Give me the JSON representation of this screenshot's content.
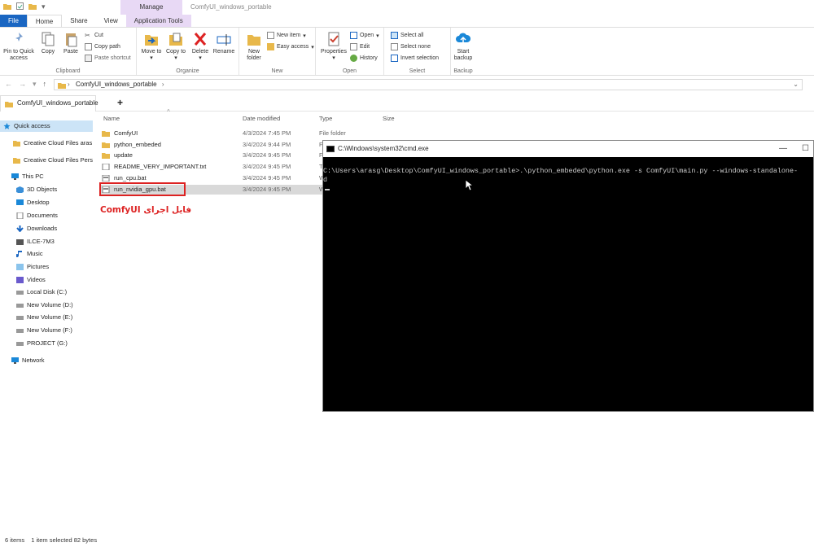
{
  "window": {
    "title": "ComfyUI_windows_portable"
  },
  "ribbon_tabs": {
    "file": "File",
    "home": "Home",
    "share": "Share",
    "view": "View",
    "manage_header": "Manage",
    "app_tools": "Application Tools"
  },
  "clipboard": {
    "pin": "Pin to Quick access",
    "copy": "Copy",
    "paste": "Paste",
    "cut": "Cut",
    "copy_path": "Copy path",
    "paste_shortcut": "Paste shortcut",
    "label": "Clipboard"
  },
  "organize": {
    "move_to": "Move to",
    "copy_to": "Copy to",
    "delete": "Delete",
    "rename": "Rename",
    "label": "Organize"
  },
  "new": {
    "new_folder": "New folder",
    "new_item": "New item",
    "easy_access": "Easy access",
    "label": "New"
  },
  "open": {
    "properties": "Properties",
    "open": "Open",
    "edit": "Edit",
    "history": "History",
    "label": "Open"
  },
  "select": {
    "select_all": "Select all",
    "select_none": "Select none",
    "invert": "Invert selection",
    "label": "Select"
  },
  "backup": {
    "start_backup": "Start backup",
    "label": "Backup"
  },
  "address": {
    "path": "ComfyUI_windows_portable"
  },
  "folder_tab": {
    "label": "ComfyUI_windows_portable",
    "add": "+"
  },
  "nav": [
    {
      "label": "Quick access",
      "icon": "star-icon"
    },
    {
      "label": "Creative Cloud Files  aras",
      "icon": "folder-icon"
    },
    {
      "label": "Creative Cloud Files Perso",
      "icon": "folder-icon"
    },
    {
      "label": "This PC",
      "icon": "pc-icon"
    },
    {
      "label": "3D Objects",
      "icon": "cube-icon"
    },
    {
      "label": "Desktop",
      "icon": "desktop-icon"
    },
    {
      "label": "Documents",
      "icon": "documents-icon"
    },
    {
      "label": "Downloads",
      "icon": "download-icon"
    },
    {
      "label": "ILCE-7M3",
      "icon": "camera-icon"
    },
    {
      "label": "Music",
      "icon": "music-icon"
    },
    {
      "label": "Pictures",
      "icon": "pictures-icon"
    },
    {
      "label": "Videos",
      "icon": "videos-icon"
    },
    {
      "label": "Local Disk (C:)",
      "icon": "drive-icon"
    },
    {
      "label": "New Volume (D:)",
      "icon": "drive-icon"
    },
    {
      "label": "New Volume (E:)",
      "icon": "drive-icon"
    },
    {
      "label": "New Volume (F:)",
      "icon": "drive-icon"
    },
    {
      "label": "PROJECT (G:)",
      "icon": "drive-icon"
    },
    {
      "label": "Network",
      "icon": "network-icon"
    }
  ],
  "columns": {
    "name": "Name",
    "date": "Date modified",
    "type": "Type",
    "size": "Size"
  },
  "files": [
    {
      "name": "ComfyUI",
      "date": "4/3/2024 7:45 PM",
      "type": "File folder",
      "kind": "folder"
    },
    {
      "name": "python_embeded",
      "date": "3/4/2024 9:44 PM",
      "type": "F",
      "kind": "folder"
    },
    {
      "name": "update",
      "date": "3/4/2024 9:45 PM",
      "type": "F",
      "kind": "folder"
    },
    {
      "name": "README_VERY_IMPORTANT.txt",
      "date": "3/4/2024 9:45 PM",
      "type": "T",
      "kind": "txt"
    },
    {
      "name": "run_cpu.bat",
      "date": "3/4/2024 9:45 PM",
      "type": "W",
      "kind": "bat"
    },
    {
      "name": "run_nvidia_gpu.bat",
      "date": "3/4/2024 9:45 PM",
      "type": "W",
      "kind": "bat"
    }
  ],
  "annotation": "فایل اجرای ComfyUI",
  "status": {
    "count": "6 items",
    "selected": "1 item selected  82 bytes"
  },
  "cmd": {
    "title": "C:\\Windows\\system32\\cmd.exe",
    "line1": "C:\\Users\\arasg\\Desktop\\ComfyUI_windows_portable>.\\python_embeded\\python.exe -s ComfyUI\\main.py --windows-standalone-",
    "line2": "d"
  }
}
